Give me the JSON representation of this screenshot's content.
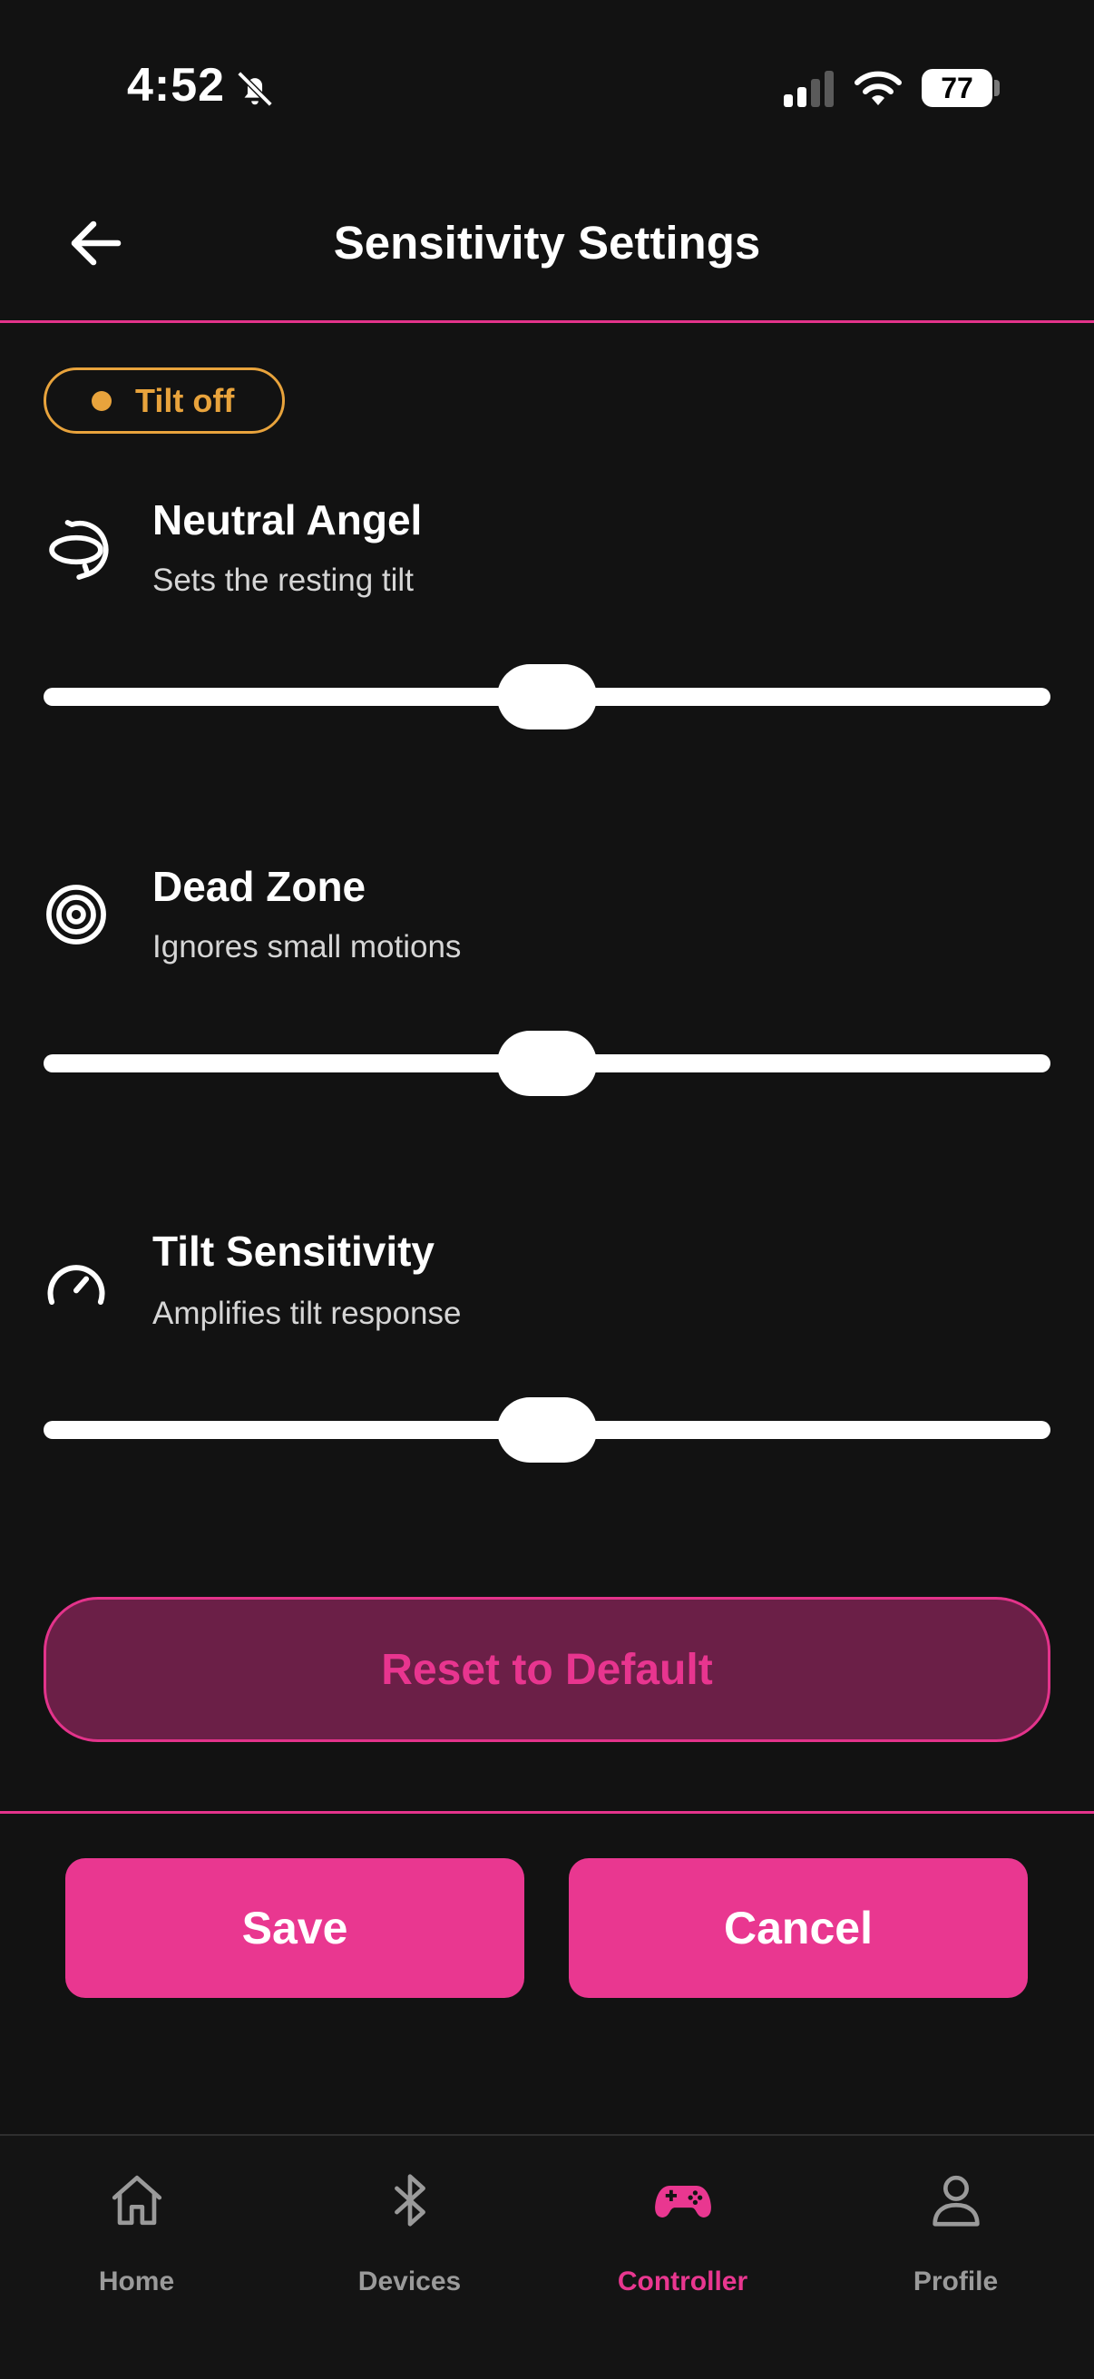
{
  "status_bar": {
    "time": "4:52",
    "battery": "77",
    "icons": [
      "bell-off-icon",
      "signal-icon",
      "wifi-icon",
      "battery-icon"
    ]
  },
  "header": {
    "title": "Sensitivity Settings",
    "back_icon": "arrow-left-icon"
  },
  "tilt_badge": {
    "label": "Tilt off",
    "color": "#e8a33c"
  },
  "settings": [
    {
      "title": "Neutral Angel",
      "description": "Sets the resting tilt",
      "icon": "rotate-icon",
      "value": 0.5
    },
    {
      "title": "Dead Zone",
      "description": "Ignores small motions",
      "icon": "target-icon",
      "value": 0.5
    },
    {
      "title": "Tilt Sensitivity",
      "description": "Amplifies tilt response",
      "icon": "gauge-icon",
      "value": 0.5
    }
  ],
  "reset_label": "Reset to Default",
  "actions": {
    "save_label": "Save",
    "cancel_label": "Cancel"
  },
  "tab_bar": {
    "tabs": [
      {
        "label": "Home",
        "icon": "home-icon",
        "active": false
      },
      {
        "label": "Devices",
        "icon": "bluetooth-icon",
        "active": false
      },
      {
        "label": "Controller",
        "icon": "gamepad-icon",
        "active": true
      },
      {
        "label": "Profile",
        "icon": "user-icon",
        "active": false
      }
    ]
  },
  "colors": {
    "accent": "#e93790",
    "accent_dark": "#6b1f47",
    "background": "#121212",
    "warning": "#e8a33c"
  }
}
